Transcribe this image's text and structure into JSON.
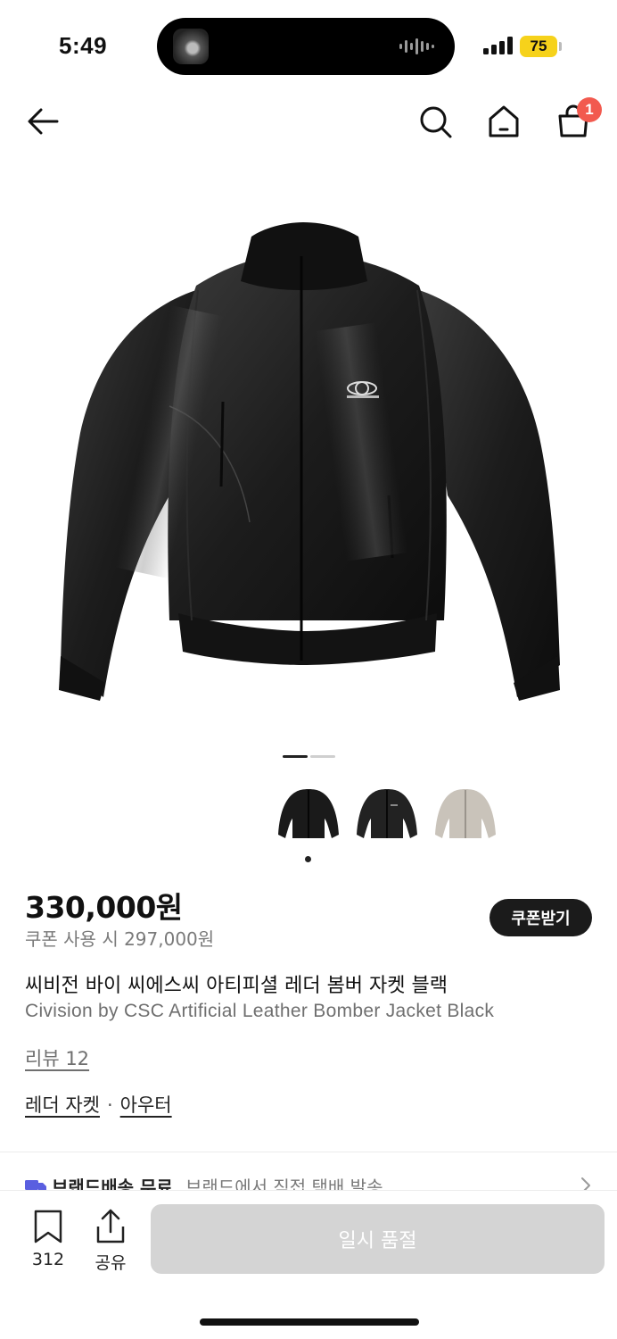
{
  "status_bar": {
    "time": "5:49",
    "battery": "75",
    "icons": [
      "signal-icon",
      "battery-icon",
      "voice-wave-icon"
    ]
  },
  "nav": {
    "icons": [
      "back-arrow-icon",
      "search-icon",
      "home-icon",
      "shopping-bag-icon"
    ],
    "cart_count": "1"
  },
  "product": {
    "image_pager": {
      "current": 1,
      "total": 2
    },
    "color_options": [
      "black-leather-jacket",
      "black-bomber-jacket",
      "beige-bomber-jacket"
    ],
    "selected_color_index": 0,
    "price": "330,000원",
    "coupon_price": "쿠폰 사용 시 297,000원",
    "coupon_button": "쿠폰받기",
    "name_ko": "씨비전 바이 씨에스씨 아티피셜 레더 봄버 자켓 블랙",
    "name_en": "Civision by CSC Artificial Leather Bomber Jacket Black",
    "review_link": "리뷰 12",
    "categories": [
      "레더 자켓",
      "아우터"
    ],
    "category_separator": "·"
  },
  "shipping": {
    "title": "브랜드배송 무료",
    "desc": "브랜드에서 직접 택배 발송"
  },
  "bottom_bar": {
    "bookmark_count": "312",
    "share_label": "공유",
    "soldout_label": "일시 품절"
  },
  "colors": {
    "accent_badge": "#f25a4f",
    "truck": "#5a5fe0",
    "soldout_bg": "#d4d4d4",
    "coupon_bg": "#1b1b1b"
  }
}
